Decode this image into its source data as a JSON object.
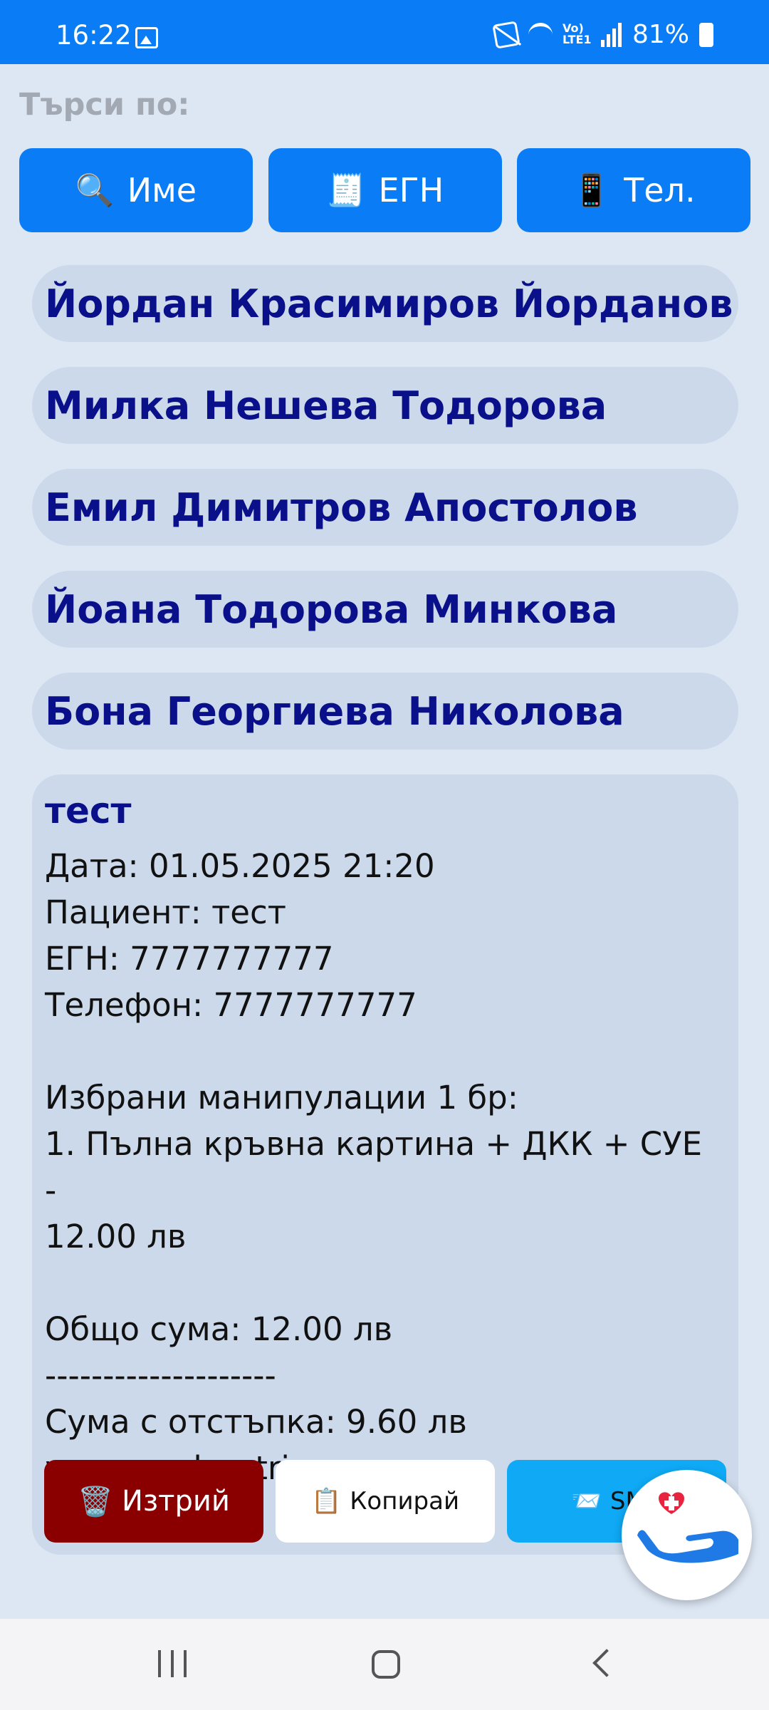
{
  "status": {
    "time": "16:22",
    "battery": "81%",
    "volte": "Vo) LTE1"
  },
  "search": {
    "label": "Търси по:",
    "buttons": [
      {
        "icon": "🔍",
        "label": "Име"
      },
      {
        "icon": "🧾",
        "label": "ЕГН"
      },
      {
        "icon": "📱",
        "label": "Тел."
      }
    ]
  },
  "patients": [
    "Йордан Красимиров Йорданов",
    "Милка Нешева Тодорова",
    "Емил Димитров Апостолов",
    "Йоана Тодорова Минкова",
    "Бона Георгиева Николова"
  ],
  "record": {
    "title": "тест",
    "date": "Дата: 01.05.2025 21:20",
    "patient": "Пациент: тест",
    "egn": "ЕГН: 7777777777",
    "phone": "Телефон: 7777777777",
    "selected": "Избрани манипулации 1 бр:",
    "item_line1": "1. Пълна кръвна картина + ДКК + СУЕ -",
    "item_line2": "12.00 лв",
    "total": "Общо сума: 12.00 лв",
    "separator": "--------------------",
    "discount": "Сума с отстъпка: 9.60 лв",
    "website": "www.medsestri.com"
  },
  "actions": {
    "delete": {
      "icon": "🗑️",
      "label": "Изтрий"
    },
    "copy": {
      "icon": "📋",
      "label": "Копирай"
    },
    "sms": {
      "icon": "📨",
      "label": "SMS"
    }
  },
  "colors": {
    "primary": "#0a7cf5",
    "background": "#dde7f4",
    "pill": "#cbd9ea",
    "name_text": "#0a0f8a",
    "delete": "#8a0000",
    "sms": "#0fa9f5"
  }
}
